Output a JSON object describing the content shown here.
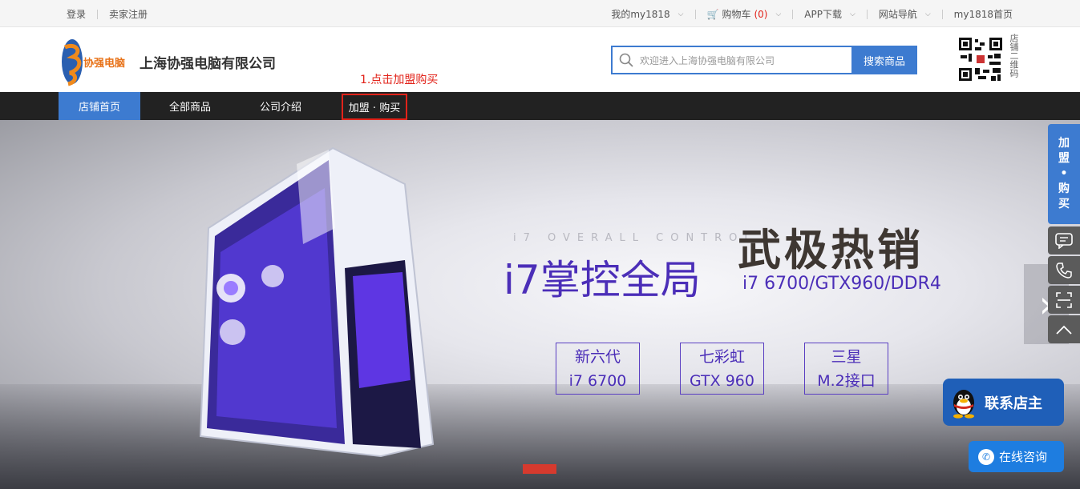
{
  "topbar": {
    "login": "登录",
    "register": "卖家注册",
    "my": "我的my1818",
    "cart_label": "购物车",
    "cart_count": "(0)",
    "app": "APP下载",
    "site_nav": "网站导航",
    "home": "my1818首页"
  },
  "header": {
    "logo_text": "协强电脑",
    "shop_name": "上海协强电脑有限公司",
    "search_placeholder": "欢迎进入上海协强电脑有限公司",
    "search_button": "搜索商品",
    "qr_label": "店铺二维码"
  },
  "annotation": "1.点击加盟购买",
  "nav": {
    "tabs": [
      "店铺首页",
      "全部商品",
      "公司介绍",
      "加盟 · 购买"
    ]
  },
  "banner": {
    "sub": "i7 OVERALL CONTROL",
    "main": "i7掌控全局",
    "hot": "武极热销",
    "spec": "i7 6700/GTX960/DDR4",
    "features": [
      {
        "l1": "新六代",
        "l2": "i7 6700"
      },
      {
        "l1": "七彩虹",
        "l2": "GTX 960"
      },
      {
        "l1": "三星",
        "l2": "M.2接口"
      }
    ]
  },
  "side": {
    "join": [
      "加",
      "盟",
      "•",
      "购",
      "买"
    ]
  },
  "contact": {
    "qq": "联系店主",
    "consult": "在线咨询"
  },
  "colors": {
    "accent": "#3d7bd0",
    "highlight": "#e2231a",
    "nav_bg": "#222222"
  }
}
